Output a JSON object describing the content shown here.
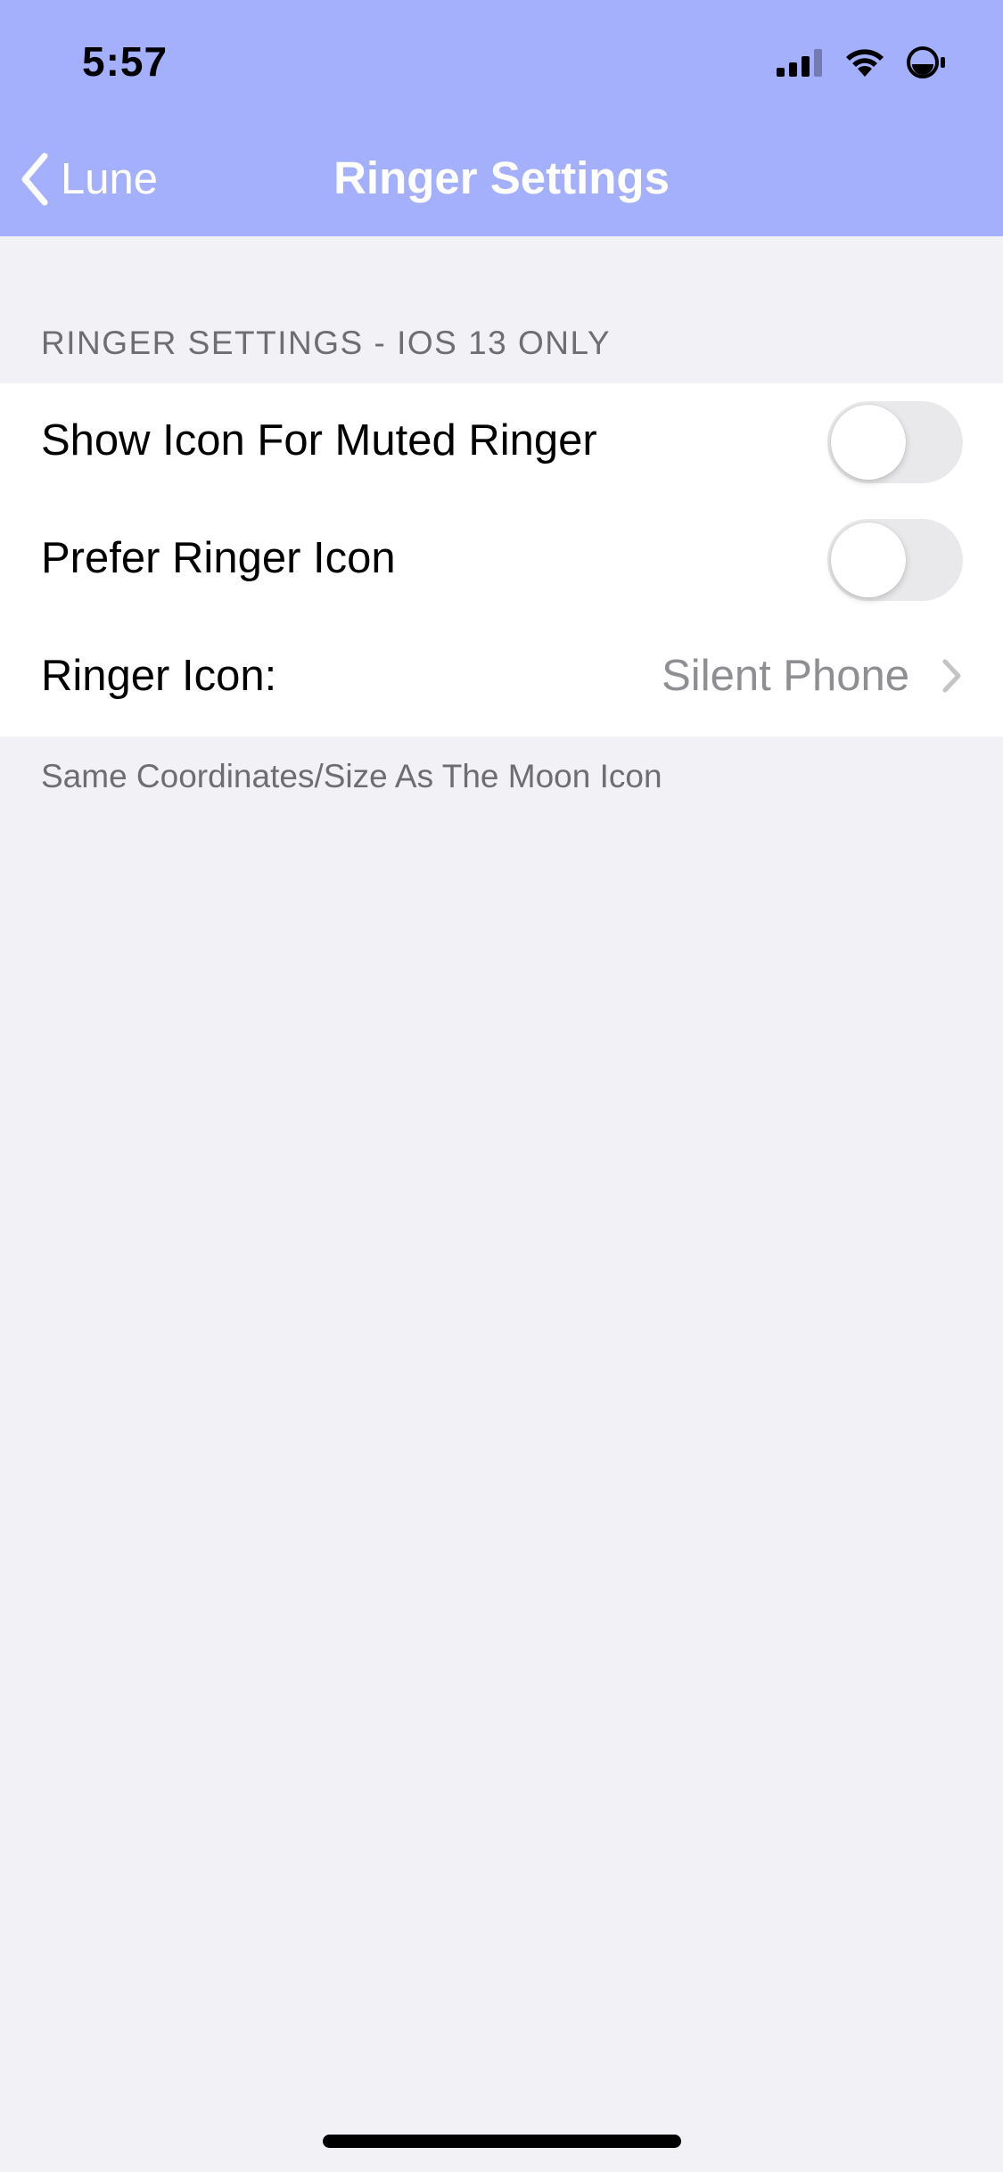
{
  "status_bar": {
    "time": "5:57",
    "icons": [
      "cellular-signal-icon",
      "wifi-icon",
      "moon-battery-icon"
    ]
  },
  "nav": {
    "back_label": "Lune",
    "title": "Ringer Settings"
  },
  "section": {
    "header": "RINGER SETTINGS - IOS 13 ONLY",
    "footer": "Same Coordinates/Size As The Moon Icon",
    "rows": [
      {
        "label": "Show Icon For Muted Ringer",
        "type": "toggle",
        "on": false
      },
      {
        "label": "Prefer Ringer Icon",
        "type": "toggle",
        "on": false
      },
      {
        "label": "Ringer Icon:",
        "type": "disclosure",
        "value": "Silent Phone"
      }
    ]
  },
  "colors": {
    "header_bg": "#a5b0fd",
    "page_bg": "#f1f1f6",
    "toggle_off": "#e9e9eb",
    "secondary_text": "#8e8e93"
  }
}
